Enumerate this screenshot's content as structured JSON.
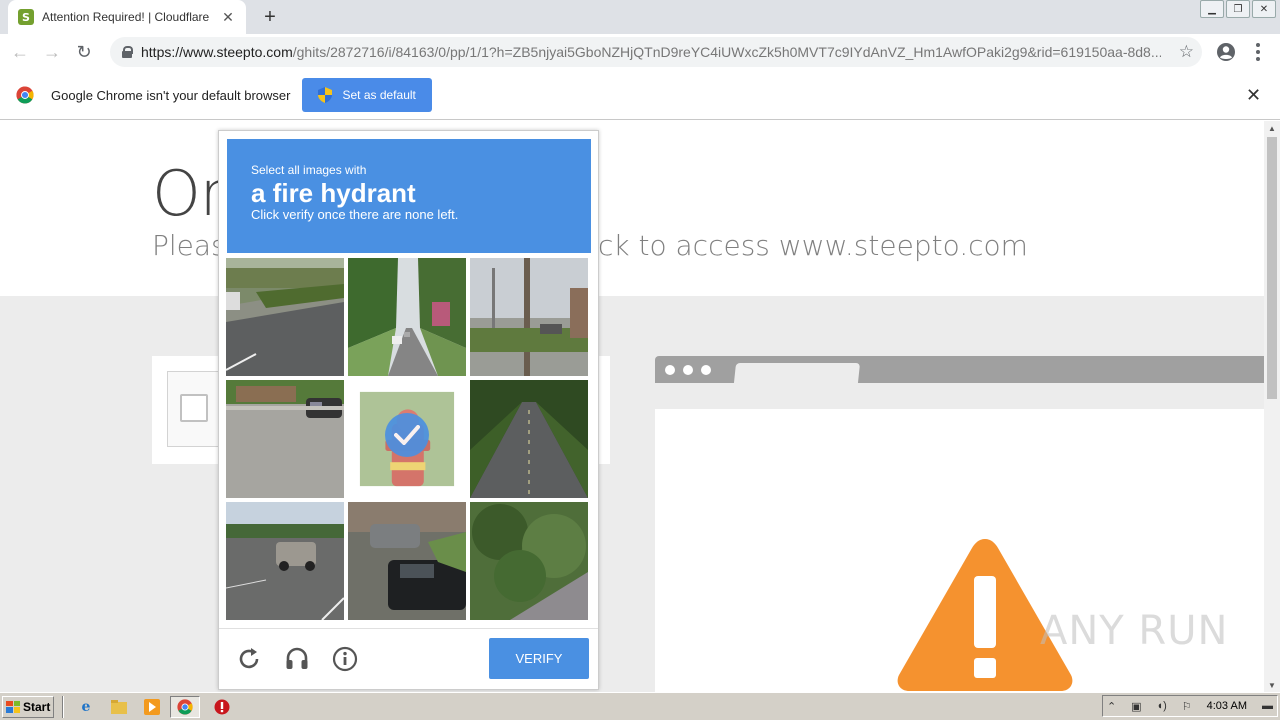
{
  "browser": {
    "tab_title": "Attention Required! | Cloudflare",
    "favicon_letter": "S",
    "url_host": "https://www.steepto.com",
    "url_path": "/ghits/2872716/i/84163/0/pp/1/1?h=ZB5njyai5GboNZHjQTnD9reYC4iUWxcZk5h0MVT7c9IYdAnVZ_Hm1AwfOPaki2g9&rid=619150aa-8d8...",
    "new_tab_symbol": "+",
    "window_controls": [
      "minimize",
      "restore",
      "close"
    ]
  },
  "infobar": {
    "message": "Google Chrome isn't your default browser",
    "button_label": "Set as default",
    "close_symbol": "✕"
  },
  "page": {
    "heading": "On",
    "subheading_left": "Pleas",
    "subheading_right": "ck to access www.steepto.com",
    "watermark": "ANY RUN"
  },
  "captcha": {
    "prompt_pre": "Select all images with",
    "target": "a fire hydrant",
    "prompt_sub": "Click verify once there are none left.",
    "verify_label": "VERIFY",
    "selected_tile": 4,
    "tiles": [
      "road-curb",
      "tree-lined-street",
      "utility-pole-street",
      "parking-lot-car",
      "fire-hydrant",
      "empty-road",
      "suv-road",
      "parked-cars",
      "bushes"
    ]
  },
  "taskbar": {
    "start_label": "Start",
    "clock": "4:03 AM"
  },
  "colors": {
    "captcha_blue": "#4a90e2",
    "chrome_button": "#4a8be8",
    "warning_orange": "#f5922f"
  }
}
